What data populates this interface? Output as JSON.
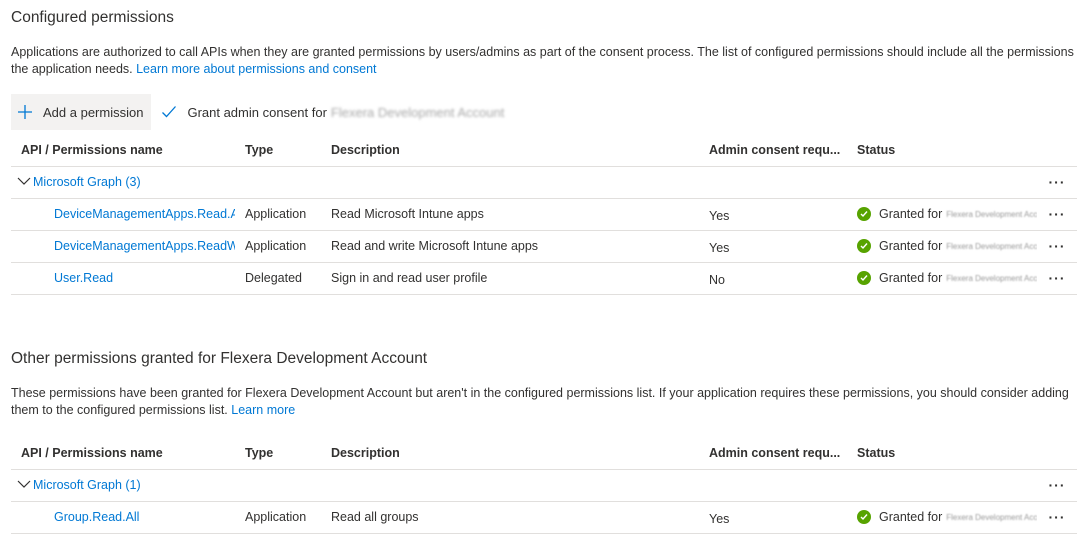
{
  "configured": {
    "title": "Configured permissions",
    "description": "Applications are authorized to call APIs when they are granted permissions by users/admins as part of the consent process. The list of configured permissions should include all the permissions the application needs.",
    "learn_more": "Learn more about permissions and consent",
    "toolbar": {
      "add_permission": "Add a permission",
      "grant_consent": "Grant admin consent for",
      "grant_consent_org": "Flexera Development Account"
    },
    "headers": {
      "name": "API / Permissions name",
      "type": "Type",
      "description": "Description",
      "admin": "Admin consent requ...",
      "status": "Status"
    },
    "group_label": "Microsoft Graph (3)",
    "rows": [
      {
        "name": "DeviceManagementApps.Read.A",
        "type": "Application",
        "description": "Read Microsoft Intune apps",
        "admin": "Yes",
        "status": "Granted for",
        "org": "Flexera Development Account"
      },
      {
        "name": "DeviceManagementApps.ReadW",
        "type": "Application",
        "description": "Read and write Microsoft Intune apps",
        "admin": "Yes",
        "status": "Granted for",
        "org": "Flexera Development Account"
      },
      {
        "name": "User.Read",
        "type": "Delegated",
        "description": "Sign in and read user profile",
        "admin": "No",
        "status": "Granted for",
        "org": "Flexera Development Account"
      }
    ]
  },
  "other": {
    "title": "Other permissions granted for Flexera Development Account",
    "description": "These permissions have been granted for Flexera Development Account but aren't in the configured permissions list. If your application requires these permissions, you should consider adding them to the configured permissions list.",
    "learn_more": "Learn more",
    "headers": {
      "name": "API / Permissions name",
      "type": "Type",
      "description": "Description",
      "admin": "Admin consent requ...",
      "status": "Status"
    },
    "group_label": "Microsoft Graph (1)",
    "rows": [
      {
        "name": "Group.Read.All",
        "type": "Application",
        "description": "Read all groups",
        "admin": "Yes",
        "status": "Granted for",
        "org": "Flexera Development Account"
      }
    ]
  },
  "more_icon": "ellipsis-icon",
  "colors": {
    "link": "#0078d4",
    "granted": "#57a300",
    "toolbar_bg": "#f3f2f1"
  }
}
